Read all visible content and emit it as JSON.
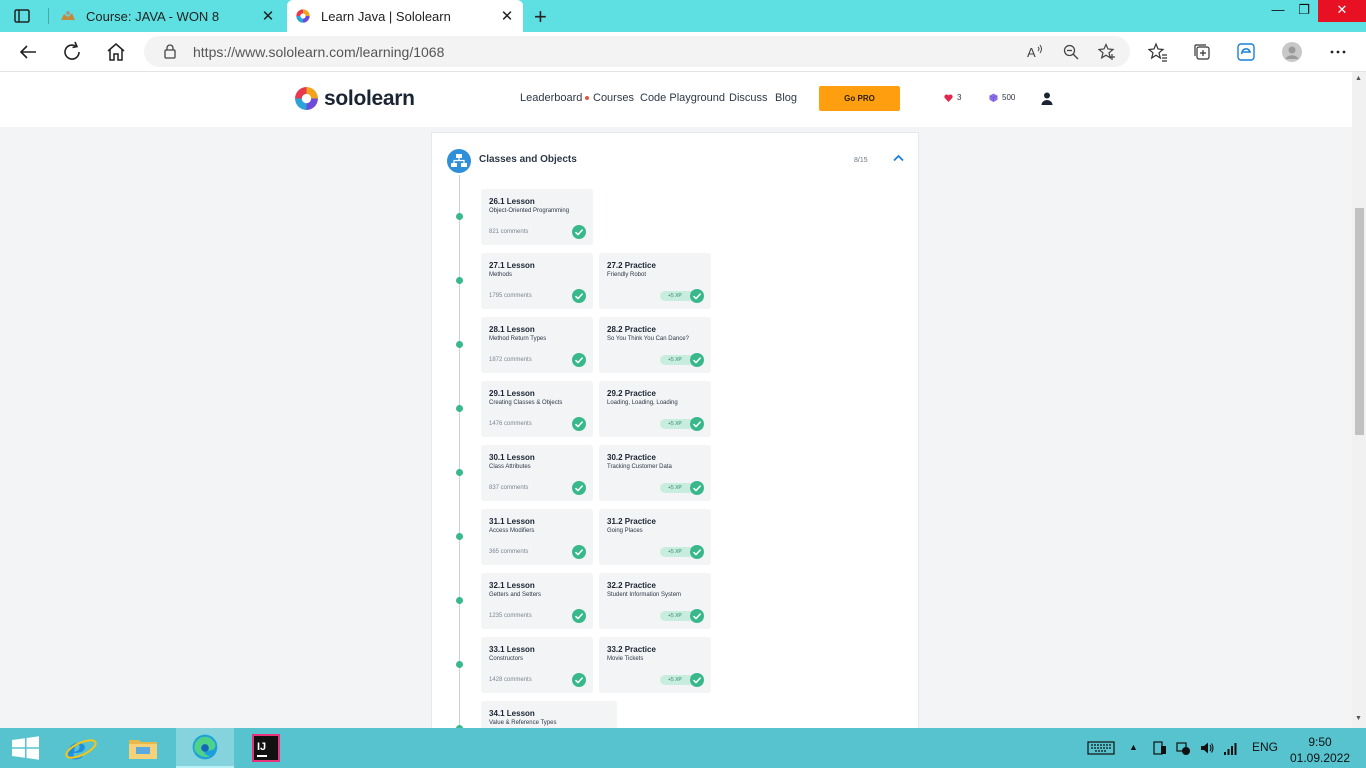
{
  "browser": {
    "tabs": [
      {
        "title": "Course: JAVA - WON 8",
        "active": false
      },
      {
        "title": "Learn Java | Sololearn",
        "active": true
      }
    ],
    "url": "https://www.sololearn.com/learning/1068"
  },
  "site": {
    "logo_text": "sololearn",
    "nav": {
      "leaderboard": "Leaderboard",
      "courses": "Courses",
      "playground": "Code Playground",
      "discuss": "Discuss",
      "blog": "Blog"
    },
    "gopro_label": "Go PRO",
    "hearts": "3",
    "bits": "500",
    "accent_color": "#39b98b",
    "pro_color": "#ff9f0f"
  },
  "module": {
    "title": "Classes and Objects",
    "progress": "8/15",
    "rows": [
      {
        "lesson": {
          "title": "26.1 Lesson",
          "subtitle": "Object-Oriented Programming",
          "comments": "821 comments"
        }
      },
      {
        "lesson": {
          "title": "27.1 Lesson",
          "subtitle": "Methods",
          "comments": "1795 comments"
        },
        "practice": {
          "title": "27.2 Practice",
          "subtitle": "Friendly Robot",
          "xp": "+5 XP"
        }
      },
      {
        "lesson": {
          "title": "28.1 Lesson",
          "subtitle": "Method Return Types",
          "comments": "1872 comments"
        },
        "practice": {
          "title": "28.2 Practice",
          "subtitle": "So You Think You Can Dance?",
          "xp": "+5 XP"
        }
      },
      {
        "lesson": {
          "title": "29.1 Lesson",
          "subtitle": "Creating Classes & Objects",
          "comments": "1476 comments"
        },
        "practice": {
          "title": "29.2 Practice",
          "subtitle": "Loading, Loading, Loading",
          "xp": "+5 XP"
        }
      },
      {
        "lesson": {
          "title": "30.1 Lesson",
          "subtitle": "Class Attributes",
          "comments": "837 comments"
        },
        "practice": {
          "title": "30.2 Practice",
          "subtitle": "Tracking Customer Data",
          "xp": "+5 XP"
        }
      },
      {
        "lesson": {
          "title": "31.1 Lesson",
          "subtitle": "Access Modifiers",
          "comments": "365 comments"
        },
        "practice": {
          "title": "31.2 Practice",
          "subtitle": "Going Places",
          "xp": "+5 XP"
        }
      },
      {
        "lesson": {
          "title": "32.1 Lesson",
          "subtitle": "Getters and Setters",
          "comments": "1235 comments"
        },
        "practice": {
          "title": "32.2 Practice",
          "subtitle": "Student Information System",
          "xp": "+5 XP"
        }
      },
      {
        "lesson": {
          "title": "33.1 Lesson",
          "subtitle": "Constructors",
          "comments": "1428 comments"
        },
        "practice": {
          "title": "33.2 Practice",
          "subtitle": "Movie Tickets",
          "xp": "+5 XP"
        }
      },
      {
        "lesson": {
          "title": "34.1 Lesson",
          "subtitle": "Value & Reference Types"
        }
      }
    ]
  },
  "taskbar": {
    "language": "ENG",
    "time": "9:50",
    "date": "01.09.2022"
  }
}
